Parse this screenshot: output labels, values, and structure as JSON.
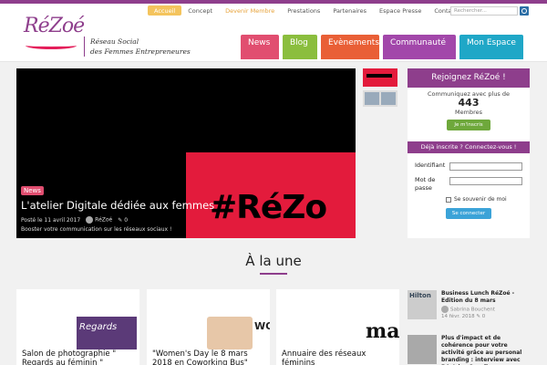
{
  "brand": {
    "logo_text": "RéZoé",
    "tagline_line1": "Réseau Social",
    "tagline_line2": "des Femmes Entrepreneures"
  },
  "topnav": [
    {
      "label": "Accueil",
      "active": true
    },
    {
      "label": "Concept"
    },
    {
      "label": "Devenir Membre"
    },
    {
      "label": "Prestations"
    },
    {
      "label": "Partenaires"
    },
    {
      "label": "Espace Presse"
    },
    {
      "label": "Contact"
    }
  ],
  "search": {
    "placeholder": "Rechercher..."
  },
  "mainnav": [
    {
      "label": "News",
      "color": "#e14e70"
    },
    {
      "label": "Blog",
      "color": "#8bbe3e"
    },
    {
      "label": "Evènements",
      "color": "#e95f36"
    },
    {
      "label": "Communauté",
      "color": "#a247aa"
    },
    {
      "label": "Mon Espace",
      "color": "#1fa7c7"
    }
  ],
  "hero": {
    "hashtag": "#RéZo",
    "category": "News",
    "title": "L'atelier Digitale dédiée aux femmes",
    "posted": "Posté le 11 avril 2017",
    "author": "RéZoé",
    "comments": "0",
    "description": "Booster votre communication sur les réseaux sociaux !"
  },
  "join": {
    "title": "Rejoignez RéZoé !",
    "text": "Communiquez avec plus de",
    "count": "443",
    "members": "Membres",
    "button": "Je m'inscris"
  },
  "login": {
    "title": "Déjà inscrite ? Connectez-vous !",
    "id_label": "Identifiant",
    "pw_label_1": "Mot de",
    "pw_label_2": "passe",
    "remember": "Se souvenir de moi",
    "button": "Se connecter"
  },
  "section": {
    "title": "À la une"
  },
  "cards": [
    {
      "caption": "Salon de photographie \" Regards au féminin \"",
      "img_text": "Regards"
    },
    {
      "caption": "\"Women's Day le 8 mars 2018 en Coworking Bus\"",
      "img_text": "WO"
    },
    {
      "caption": "Annuaire des réseaux féminins",
      "img_text": "marie"
    }
  ],
  "news": [
    {
      "title": "Business Lunch RéZoé - Edition du 8 mars",
      "author": "Sabrina Bouchent",
      "date": "14 févr. 2018",
      "comments": "0",
      "thumb_text": "Hilton"
    },
    {
      "title": "Plus d'impact et de cohérence pour votre activité grâce au personal branding : interview avec Béatrice Cuvelier"
    }
  ],
  "colors": {
    "brand_purple": "#8e3e8c",
    "accent_pink": "#e14e70",
    "hero_red": "#e31b3c"
  }
}
